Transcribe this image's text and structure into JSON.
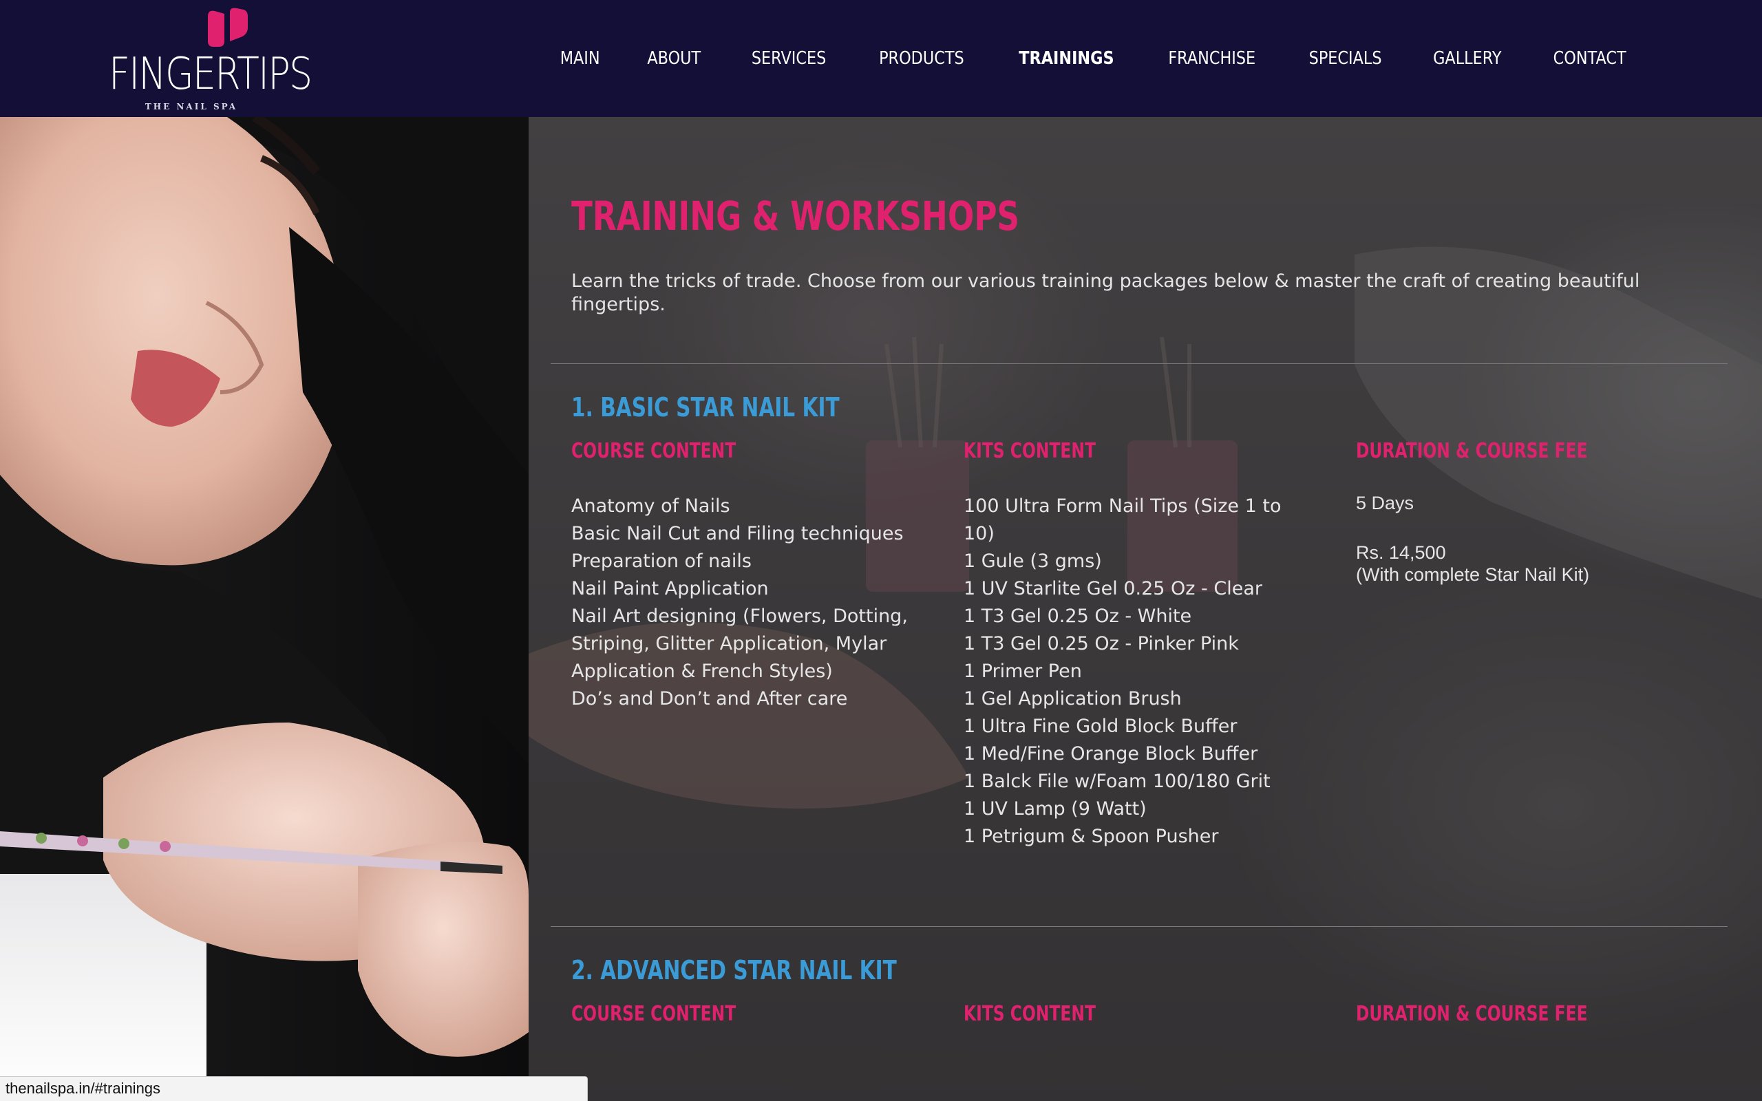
{
  "brand": {
    "name": "FINGERTIPS",
    "tagline": "THE NAIL SPA",
    "accent_color": "#e0216e",
    "header_color": "#130f37"
  },
  "nav": {
    "items": [
      {
        "label": "MAIN",
        "active": false
      },
      {
        "label": "ABOUT",
        "active": false
      },
      {
        "label": "SERVICES",
        "active": false
      },
      {
        "label": "PRODUCTS",
        "active": false
      },
      {
        "label": "TRAININGS",
        "active": true
      },
      {
        "label": "FRANCHISE",
        "active": false
      },
      {
        "label": "SPECIALS",
        "active": false
      },
      {
        "label": "GALLERY",
        "active": false
      },
      {
        "label": "CONTACT",
        "active": false
      }
    ]
  },
  "hero_image": {
    "icon": "woman-painting-nails-photo"
  },
  "main": {
    "title": "TRAINING & WORKSHOPS",
    "intro": "Learn the tricks of trade. Choose from our various training packages below & master the craft of creating beautiful fingertips."
  },
  "courses": [
    {
      "heading": "1. BASIC STAR NAIL KIT",
      "course_content_label": "COURSE CONTENT",
      "kits_content_label": "KITS CONTENT",
      "fee_label": "DURATION & COURSE FEE",
      "course_content": [
        "Anatomy of Nails",
        "Basic Nail Cut and Filing techniques",
        "Preparation of nails",
        "Nail Paint Application",
        "Nail Art designing (Flowers, Dotting,",
        "Striping, Glitter Application, Mylar",
        "Application & French Styles)",
        "Do’s and Don’t and After care"
      ],
      "kits_content": [
        "100 Ultra Form Nail Tips (Size 1 to",
        "10)",
        "1 Gule (3 gms)",
        "1 UV Starlite Gel 0.25 Oz - Clear",
        "1 T3 Gel 0.25 Oz - White",
        "1 T3 Gel 0.25 Oz - Pinker Pink",
        "1 Primer Pen",
        "1 Gel Application Brush",
        "1 Ultra Fine Gold Block Buffer",
        "1 Med/Fine Orange Block Buffer",
        "1 Balck File w/Foam 100/180 Grit",
        "1 UV Lamp (9 Watt)",
        "1 Petrigum & Spoon Pusher"
      ],
      "duration": "5 Days",
      "fee": "Rs. 14,500",
      "fee_note": "(With complete Star Nail Kit)"
    },
    {
      "heading": "2. ADVANCED STAR NAIL KIT",
      "course_content_label": "COURSE CONTENT",
      "kits_content_label": "KITS CONTENT",
      "fee_label": "DURATION & COURSE FEE"
    }
  ],
  "statusbar": {
    "url": "thenailspa.in/#trainings"
  }
}
